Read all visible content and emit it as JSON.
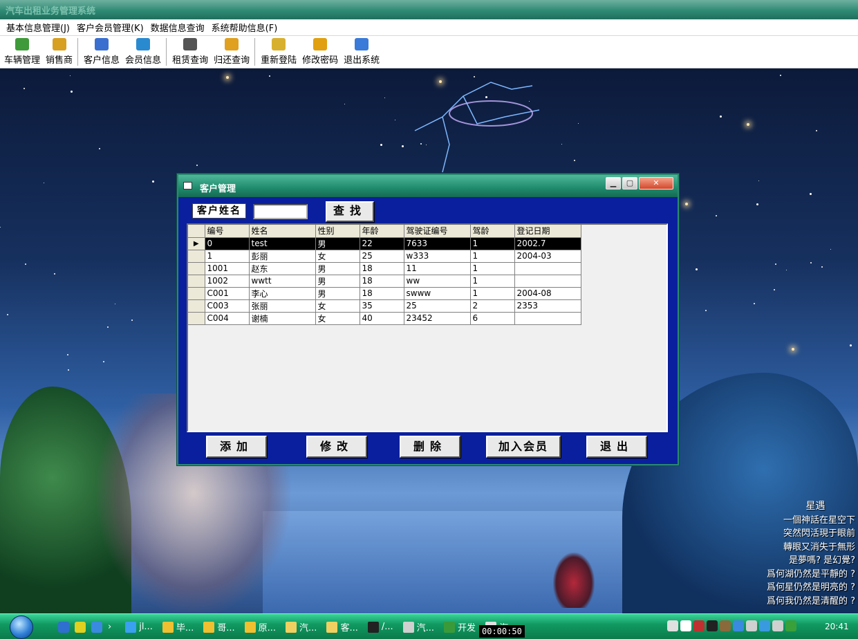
{
  "app": {
    "title": "汽车出租业务管理系统"
  },
  "menu": [
    {
      "label": "基本信息管理(J)"
    },
    {
      "label": "客户会员管理(K)"
    },
    {
      "label": "数据信息查询"
    },
    {
      "label": "系统帮助信息(F)"
    }
  ],
  "toolbar": {
    "groups": [
      [
        {
          "label": "车辆管理",
          "icon": "car-icon",
          "color": "#3f9a3a"
        },
        {
          "label": "销售商",
          "icon": "film-icon",
          "color": "#d8a020"
        }
      ],
      [
        {
          "label": "客户信息",
          "icon": "person-icon",
          "color": "#3a6fd0"
        },
        {
          "label": "会员信息",
          "icon": "pen-icon",
          "color": "#2a8ad0"
        }
      ],
      [
        {
          "label": "租赁查询",
          "icon": "binoculars-icon",
          "color": "#555555"
        },
        {
          "label": "归还查询",
          "icon": "windows-icon",
          "color": "#e0a020"
        }
      ],
      [
        {
          "label": "重新登陆",
          "icon": "login-icon",
          "color": "#d8b030"
        },
        {
          "label": "修改密码",
          "icon": "key-icon",
          "color": "#e0a010"
        },
        {
          "label": "退出系统",
          "icon": "exit-icon",
          "color": "#3a7ad8"
        }
      ]
    ]
  },
  "dialog": {
    "title": "客户管理",
    "controls": {
      "minimize": "▁",
      "maximize": "▢",
      "close": "✕"
    },
    "search": {
      "label": "客户姓名",
      "value": "",
      "button": "查找"
    },
    "grid": {
      "columns": [
        "编号",
        "姓名",
        "性别",
        "年龄",
        "驾驶证编号",
        "驾龄",
        "登记日期"
      ],
      "rows": [
        [
          "0",
          "test",
          "男",
          "22",
          "7633",
          "1",
          "2002.7"
        ],
        [
          "1",
          "彭丽",
          "女",
          "25",
          "w333",
          "1",
          "2004-03"
        ],
        [
          "1001",
          "赵东",
          "男",
          "18",
          "11",
          "1",
          ""
        ],
        [
          "1002",
          "wwtt",
          "男",
          "18",
          "ww",
          "1",
          ""
        ],
        [
          "C001",
          "李心",
          "男",
          "18",
          "swww",
          "1",
          "2004-08"
        ],
        [
          "C003",
          "张丽",
          "女",
          "35",
          "25",
          "2",
          "2353"
        ],
        [
          "C004",
          "谢楠",
          "女",
          "40",
          "23452",
          "6",
          ""
        ]
      ],
      "selected_row": 0
    },
    "buttons": {
      "add": "添加",
      "edit": "修改",
      "delete": "删除",
      "join": "加入会员",
      "exit": "退出"
    }
  },
  "desktop": {
    "poem": {
      "title": "星遇",
      "lines": [
        "一個神話在星空下",
        "突然閃活現于眼前",
        "轉眼又消失于無形",
        "是夢嗎? 是幻覺?",
        "爲何湖仍然是平靜的 ?",
        "爲何星仍然是明亮的 ?",
        "爲何我仍然是清醒的 ?"
      ]
    }
  },
  "taskbar": {
    "quick_launch": [
      {
        "icon": "show-desktop-icon",
        "color": "#2f6fd0"
      },
      {
        "icon": "add-icon",
        "color": "#e0d020"
      },
      {
        "icon": "ie-icon",
        "color": "#3a8ae0"
      }
    ],
    "chevron": "›",
    "items": [
      {
        "label": "jl...",
        "icon": "qq-browser-icon",
        "color": "#3aa0f0"
      },
      {
        "label": "毕...",
        "icon": "folder-icon",
        "color": "#f0c030"
      },
      {
        "label": "哥...",
        "icon": "folder-icon",
        "color": "#f0c030"
      },
      {
        "label": "原...",
        "icon": "folder-icon",
        "color": "#f0c030"
      },
      {
        "label": "汽...",
        "icon": "folder-open-icon",
        "color": "#f0d060"
      },
      {
        "label": "客...",
        "icon": "folder-open-icon",
        "color": "#f0d060"
      },
      {
        "label": "/...",
        "icon": "qq-icon",
        "color": "#222222"
      },
      {
        "label": "汽...",
        "icon": "app-icon",
        "color": "#d0d0d0"
      },
      {
        "label": "开发",
        "icon": "tree-icon",
        "color": "#3a9a3a"
      },
      {
        "label": "汽...",
        "icon": "window-icon",
        "color": "#e0e0e0"
      }
    ],
    "timer": "00:00:50",
    "tray": [
      {
        "icon": "keyboard-icon",
        "color": "#e0e0e0"
      },
      {
        "icon": "help-icon",
        "color": "#ffffff"
      },
      {
        "icon": "game-icon",
        "color": "#c03030"
      },
      {
        "icon": "qq-tray-icon",
        "color": "#222222"
      },
      {
        "icon": "user-icon",
        "color": "#8a6a3a"
      },
      {
        "icon": "network-icon",
        "color": "#3a8ae0"
      },
      {
        "icon": "monitor-icon",
        "color": "#d0d0d0"
      },
      {
        "icon": "wifi-icon",
        "color": "#3a9ae0"
      },
      {
        "icon": "volume-icon",
        "color": "#d0d0d0"
      },
      {
        "icon": "shield-icon",
        "color": "#3aa03a"
      }
    ],
    "clock": "20:41"
  }
}
